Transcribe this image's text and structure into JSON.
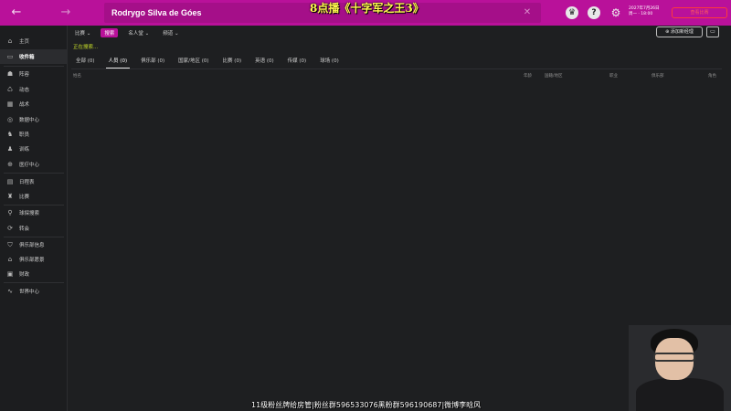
{
  "topbar": {
    "back_icon": "arrow-left-icon",
    "forward_icon": "arrow-right-icon",
    "search_value": "Rodrygo Silva de Góes",
    "stream_banner": "8点播《十字军之王3》",
    "date_line1": "2027年7月26日",
    "date_line2": "周一 · 18:00",
    "continue_label": "查看比赛",
    "accent": "#b9119a"
  },
  "sidebar": {
    "items": [
      {
        "label": "主页",
        "icon": "home-icon"
      },
      {
        "label": "收件箱",
        "icon": "inbox-icon"
      },
      {
        "label": "阵容",
        "icon": "squad-icon"
      },
      {
        "label": "动态",
        "icon": "dynamics-icon"
      },
      {
        "label": "战术",
        "icon": "tactics-icon"
      },
      {
        "label": "数据中心",
        "icon": "data-hub-icon"
      },
      {
        "label": "职员",
        "icon": "staff-icon"
      },
      {
        "label": "训练",
        "icon": "training-icon"
      },
      {
        "label": "医疗中心",
        "icon": "medical-icon"
      },
      {
        "label": "日程表",
        "icon": "schedule-icon"
      },
      {
        "label": "比赛",
        "icon": "competitions-icon"
      },
      {
        "label": "球探搜索",
        "icon": "scouting-icon"
      },
      {
        "label": "转会",
        "icon": "transfers-icon"
      },
      {
        "label": "俱乐部信息",
        "icon": "club-info-icon"
      },
      {
        "label": "俱乐部愿景",
        "icon": "club-vision-icon"
      },
      {
        "label": "财政",
        "icon": "finances-icon"
      },
      {
        "label": "世界中心",
        "icon": "world-icon"
      }
    ]
  },
  "subnav": {
    "items": [
      "比赛",
      "搜索",
      "名人堂",
      "频道"
    ],
    "new_task_label": "添加新经理"
  },
  "search_status": "正在搜索...",
  "tabs": [
    "全部 (0)",
    "人员 (0)",
    "俱乐部 (0)",
    "国家/地区 (0)",
    "比赛 (0)",
    "英语 (0)",
    "传媒 (0)",
    "球场 (0)"
  ],
  "columns": [
    "姓名",
    "年龄",
    "国籍/地区",
    "职业",
    "俱乐部",
    "角色"
  ],
  "caption": "11级粉丝牌给房管|粉丝群596533076黑粉群596190687|微博李晗风"
}
